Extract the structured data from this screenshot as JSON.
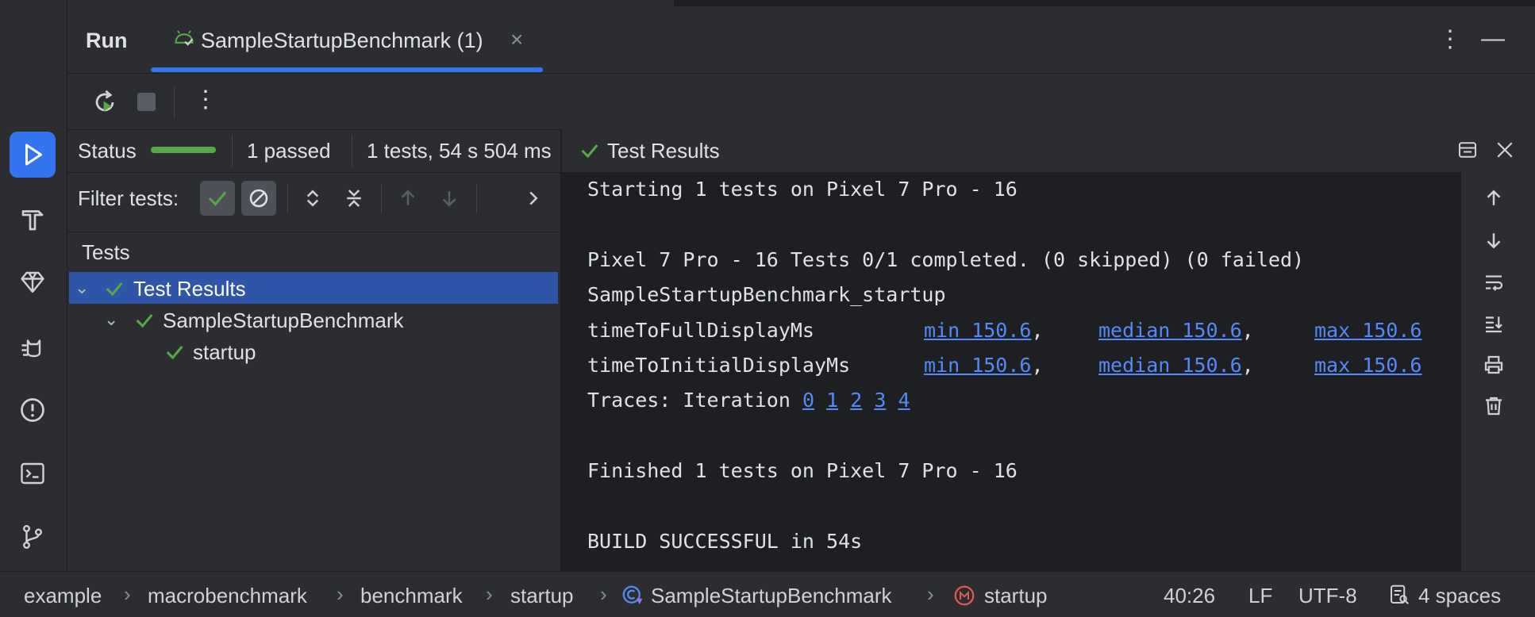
{
  "window": {
    "panel_title": "Run",
    "tab_label": "SampleStartupBenchmark (1)"
  },
  "status": {
    "label": "Status",
    "progress": 1.0,
    "passed": "1 passed",
    "tests_time": "1 tests, 54 s 504 ms"
  },
  "filter": {
    "label": "Filter tests:"
  },
  "tree": {
    "header": "Tests",
    "rows": [
      {
        "label": "Test Results",
        "level": 0
      },
      {
        "label": "SampleStartupBenchmark",
        "level": 1
      },
      {
        "label": "startup",
        "level": 2
      }
    ]
  },
  "console": {
    "title": "Test Results",
    "lines": {
      "l1": "Starting 1 tests on Pixel 7 Pro - 16",
      "l2": "Pixel 7 Pro - 16 Tests 0/1 completed. (0 skipped) (0 failed)",
      "l3": "SampleStartupBenchmark_startup",
      "full_name": "timeToFullDisplayMs",
      "initial_name": "timeToInitialDisplayMs",
      "min": "min 150.6",
      "median": "median 150.6",
      "max": "max 150.6",
      "traces_label": "Traces: Iteration",
      "iter": [
        "0",
        "1",
        "2",
        "3",
        "4"
      ],
      "finished": "Finished 1 tests on Pixel 7 Pro - 16",
      "build": "BUILD SUCCESSFUL in 54s"
    }
  },
  "footer": {
    "crumbs": [
      "example",
      "macrobenchmark",
      "benchmark",
      "startup",
      "SampleStartupBenchmark",
      "startup"
    ],
    "position": "40:26",
    "line_sep": "LF",
    "encoding": "UTF-8",
    "indent": "4 spaces"
  },
  "colors": {
    "accent": "#3574f0",
    "pass_green": "#57a64a",
    "link": "#548af7"
  }
}
